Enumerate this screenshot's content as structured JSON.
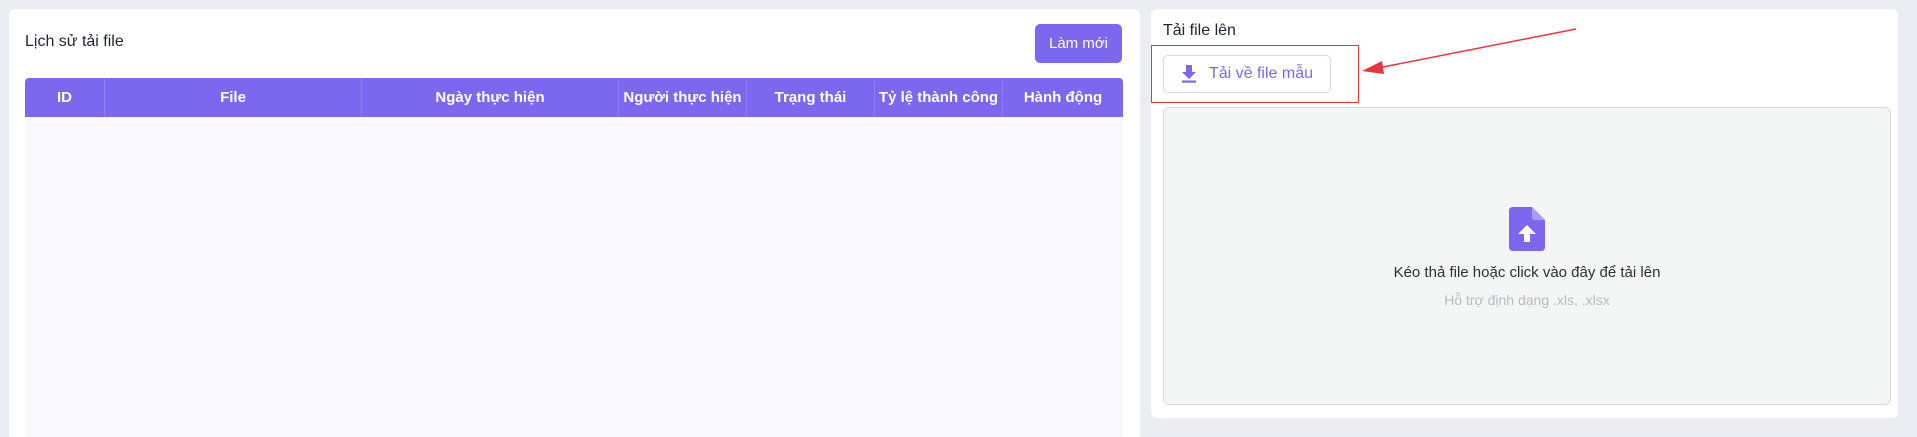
{
  "history": {
    "title": "Lịch sử tải file",
    "refresh_label": "Làm mới",
    "columns": [
      "ID",
      "File",
      "Ngày thực hiện",
      "Người thực hiện",
      "Trạng thái",
      "Tỷ lệ thành công",
      "Hành động"
    ]
  },
  "upload": {
    "title": "Tải file lên",
    "download_template_label": "Tải về file mẫu",
    "dropzone_text": "Kéo thả file hoặc click vào đây để tải lên",
    "dropzone_hint": "Hỗ trợ định dạng .xls, .xlsx"
  },
  "colors": {
    "accent": "#7b68ee",
    "annotation": "#e8343d"
  },
  "icons": {
    "download": "download-icon",
    "upload_file": "file-upload-icon"
  }
}
